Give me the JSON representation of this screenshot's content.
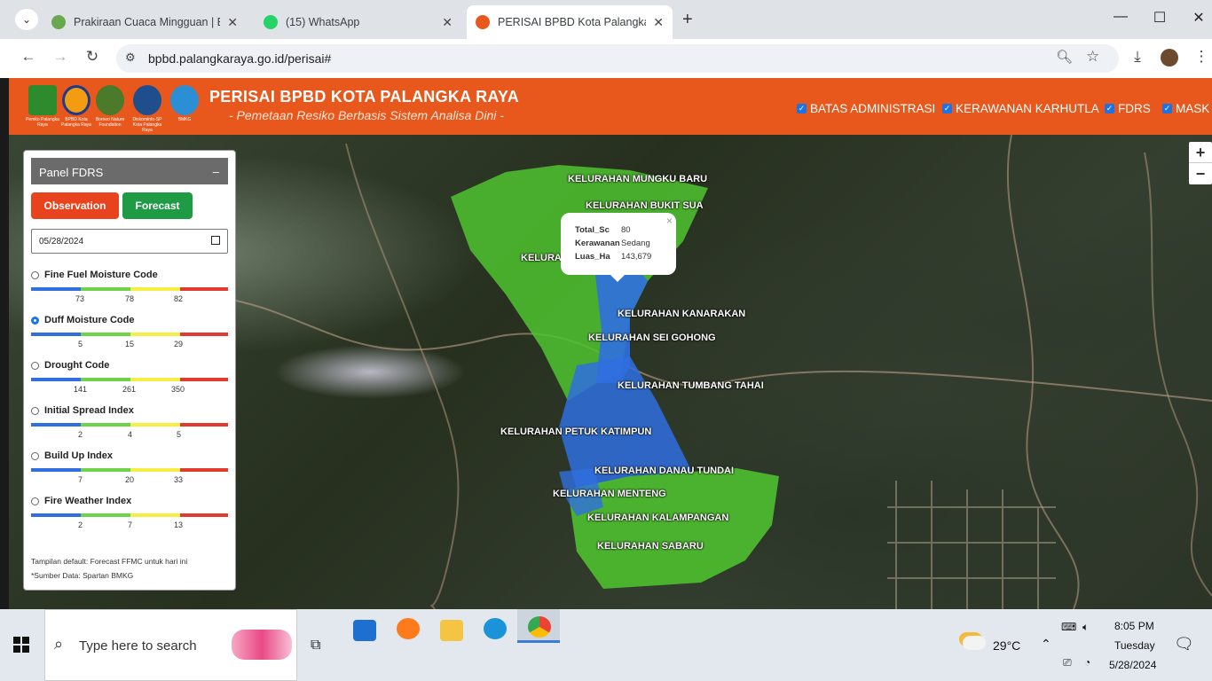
{
  "browser": {
    "tabs": [
      {
        "title": "Prakiraan Cuaca Mingguan | BM"
      },
      {
        "title": "(15) WhatsApp"
      },
      {
        "title": "PERISAI BPBD Kota Palangka Ra"
      }
    ],
    "new_tab": "+",
    "url": "bpbd.palangkaraya.go.id/perisai#"
  },
  "header": {
    "title": "PERISAI BPBD KOTA PALANGKA RAYA",
    "subtitle": "- Pemetaan Resiko Berbasis Sistem Analisa Dini -",
    "logos": [
      {
        "caption": "Pemko Palangka Raya"
      },
      {
        "caption": "BPBD Kota Palangka Raya"
      },
      {
        "caption": "Borneo Nature Foundation"
      },
      {
        "caption": "Diskominfo-SP Kota Palangka Raya"
      },
      {
        "caption": "BMKG"
      }
    ],
    "layers": [
      "BATAS ADMINISTRASI",
      "KERAWANAN KARHUTLA",
      "FDRS",
      "MASK"
    ]
  },
  "map": {
    "labels": [
      "KELURAHAN MUNGKU BARU",
      "KELURAHAN BUKIT SUA",
      "KELURA",
      "KELURAHAN KANARAKAN",
      "KELURAHAN SEI GOHONG",
      "KELURAHAN TUMBANG TAHAI",
      "KELURAHAN PETUK KATIMPUN",
      "KELURAHAN DANAU TUNDAI",
      "KELURAHAN MENTENG",
      "KELURAHAN KALAMPANGAN",
      "KELURAHAN SABARU"
    ],
    "zoom_in": "+",
    "zoom_out": "−",
    "popup": {
      "rows": [
        {
          "key": "Total_Sc",
          "value": "80"
        },
        {
          "key": "Kerawanan",
          "value": "Sedang"
        },
        {
          "key": "Luas_Ha",
          "value": "143,679"
        }
      ],
      "close": "×"
    }
  },
  "panel": {
    "title": "Panel FDRS",
    "minimize": "–",
    "tab_observation": "Observation",
    "tab_forecast": "Forecast",
    "date": "05/28/2024",
    "indices": [
      {
        "name": "Fine Fuel Moisture Code",
        "ticks": [
          "73",
          "78",
          "82"
        ],
        "selected": false
      },
      {
        "name": "Duff Moisture Code",
        "ticks": [
          "5",
          "15",
          "29"
        ],
        "selected": true
      },
      {
        "name": "Drought Code",
        "ticks": [
          "141",
          "261",
          "350"
        ],
        "selected": false
      },
      {
        "name": "Initial Spread Index",
        "ticks": [
          "2",
          "4",
          "5"
        ],
        "selected": false
      },
      {
        "name": "Build Up Index",
        "ticks": [
          "7",
          "20",
          "33"
        ],
        "selected": false
      },
      {
        "name": "Fire Weather Index",
        "ticks": [
          "2",
          "7",
          "13"
        ],
        "selected": false
      }
    ],
    "colors": {
      "blue": "#2f6fe0",
      "green": "#6fd34a",
      "yellow": "#f7ee43",
      "red": "#e23a2e"
    },
    "note_default": "Tampilan default: Forecast FFMC untuk hari ini",
    "note_source": "*Sumber Data: Spartan BMKG"
  },
  "taskbar": {
    "search_placeholder": "Type here to search",
    "weather": "29°C",
    "time": "8:05 PM",
    "day": "Tuesday",
    "date": "5/28/2024"
  }
}
